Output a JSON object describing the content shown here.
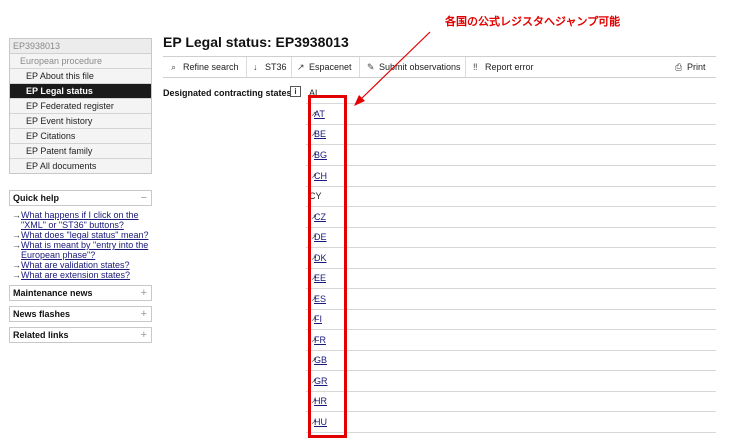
{
  "sidebar": {
    "header": "EP3938013",
    "subheader": "European procedure",
    "items": [
      {
        "label": "EP About this file",
        "active": false
      },
      {
        "label": "EP Legal status",
        "active": true
      },
      {
        "label": "EP Federated register",
        "active": false
      },
      {
        "label": "EP Event history",
        "active": false
      },
      {
        "label": "EP Citations",
        "active": false
      },
      {
        "label": "EP Patent family",
        "active": false
      },
      {
        "label": "EP All documents",
        "active": false
      }
    ],
    "quick_help": {
      "title": "Quick help",
      "toggle": "−",
      "links": [
        "What happens if I click on the \"XML\" or \"ST36\" buttons?",
        "What does \"legal status\" mean?",
        "What is meant by \"entry into the European phase\"?",
        "What are validation states?",
        "What are extension states?"
      ]
    },
    "panels": [
      {
        "title": "Maintenance news",
        "toggle": "+"
      },
      {
        "title": "News flashes",
        "toggle": "+"
      },
      {
        "title": "Related links",
        "toggle": "+"
      }
    ]
  },
  "main": {
    "title": "EP Legal status: EP3938013",
    "toolbar": {
      "refine": "Refine search",
      "st36": "ST36",
      "espacenet": "Espacenet",
      "submit": "Submit observations",
      "report": "Report error",
      "print": "Print"
    },
    "dcs_label": "Designated contracting states",
    "info_icon": "i",
    "states": [
      {
        "code": "AL",
        "link": false
      },
      {
        "code": "AT",
        "link": true
      },
      {
        "code": "BE",
        "link": true
      },
      {
        "code": "BG",
        "link": true
      },
      {
        "code": "CH",
        "link": true
      },
      {
        "code": "CY",
        "link": false
      },
      {
        "code": "CZ",
        "link": true
      },
      {
        "code": "DE",
        "link": true
      },
      {
        "code": "DK",
        "link": true
      },
      {
        "code": "EE",
        "link": true
      },
      {
        "code": "ES",
        "link": true
      },
      {
        "code": "FI",
        "link": true
      },
      {
        "code": "FR",
        "link": true
      },
      {
        "code": "GB",
        "link": true
      },
      {
        "code": "GR",
        "link": true
      },
      {
        "code": "HR",
        "link": true
      },
      {
        "code": "HU",
        "link": true
      }
    ]
  },
  "annotation": {
    "text": "各国の公式レジスタへジャンプ可能",
    "color": "#e20000"
  }
}
